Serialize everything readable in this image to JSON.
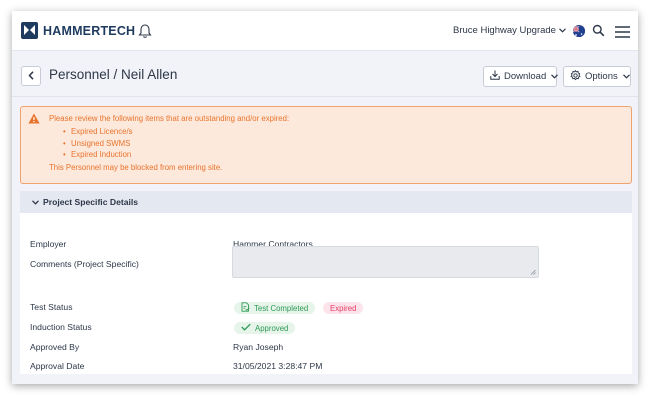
{
  "nav": {
    "logo_text": "HAMMERTECH",
    "project_name": "Bruce Highway Upgrade",
    "icons": [
      "hammertech-logo-icon",
      "bell-icon",
      "chevron-down-icon",
      "australia-flag-icon",
      "search-icon",
      "hamburger-menu-icon"
    ]
  },
  "header": {
    "title": "Personnel / Neil Allen",
    "download_label": "Download",
    "options_label": "Options"
  },
  "alert": {
    "message": "Please review the following items that are outstanding and/or expired:",
    "items": [
      "Expired Licence/s",
      "Unsigned SWMS",
      "Expired Induction"
    ],
    "footer": "This Personnel may be blocked from entering site."
  },
  "section": {
    "title": "Project Specific Details",
    "employer_label": "Employer",
    "employer_value": "Hammer Contractors",
    "comments_label": "Comments (Project Specific)",
    "comments_value": "",
    "test_status_label": "Test Status",
    "test_completed_badge": "Test Completed",
    "expired_badge": "Expired",
    "induction_status_label": "Induction Status",
    "induction_badge": "Approved",
    "approved_by_label": "Approved By",
    "approved_by_value": "Ryan Joseph",
    "approval_date_label": "Approval Date",
    "approval_date_value": "31/05/2021 3:28:47 PM"
  },
  "colors": {
    "brand": "#1e3a5f",
    "alert_text": "#e8732c",
    "alert_bg": "#fde9dc",
    "success": "#2e9a55",
    "danger": "#e33c68"
  }
}
